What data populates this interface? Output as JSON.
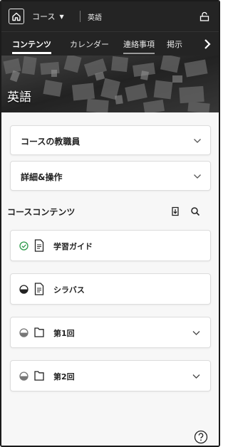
{
  "topbar": {
    "course_switch_label": "コース",
    "course_name": "英語"
  },
  "tabs": [
    {
      "label": "コンテンツ"
    },
    {
      "label": "カレンダー"
    },
    {
      "label": "連絡事項"
    },
    {
      "label": "掲示"
    }
  ],
  "banner": {
    "title": "英語"
  },
  "accordions": [
    {
      "label": "コースの教職員"
    },
    {
      "label": "詳細&操作"
    }
  ],
  "section": {
    "title": "コースコンテンツ"
  },
  "items": [
    {
      "label": "学習ガイド",
      "type_icon": "document-icon",
      "status_icon": "check-circle-icon",
      "status_color": "#2e9b4b"
    },
    {
      "label": "シラバス",
      "type_icon": "document-icon",
      "status_icon": "half-circle-icon"
    },
    {
      "label": "第1回",
      "type_icon": "folder-icon",
      "status_icon": "half-circle-icon",
      "expandable": true
    },
    {
      "label": "第2回",
      "type_icon": "folder-icon",
      "status_icon": "half-circle-icon",
      "expandable": true
    }
  ],
  "colors": {
    "header_bg": "#242424",
    "page_bg": "#f7f7f7",
    "success": "#2e9b4b"
  }
}
